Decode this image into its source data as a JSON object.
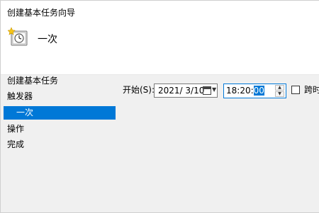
{
  "window": {
    "title": "创建基本任务向导"
  },
  "header": {
    "task_name": "一次",
    "icon": "scheduled-task-icon"
  },
  "steps": [
    {
      "label": "创建基本任务",
      "selected": false
    },
    {
      "label": "触发器",
      "selected": false
    },
    {
      "label": "一次",
      "selected": true
    },
    {
      "label": "操作",
      "selected": false
    },
    {
      "label": "完成",
      "selected": false
    }
  ],
  "form": {
    "start_label": "开始(S):",
    "date_value": "2021/  3/10",
    "time_prefix": "18:20:",
    "time_selected": "00",
    "checkbox_label": "跨时",
    "checkbox_checked": false
  },
  "colors": {
    "accent": "#0078d7",
    "background": "#f0f0f0",
    "header_bg": "#ffffff"
  }
}
